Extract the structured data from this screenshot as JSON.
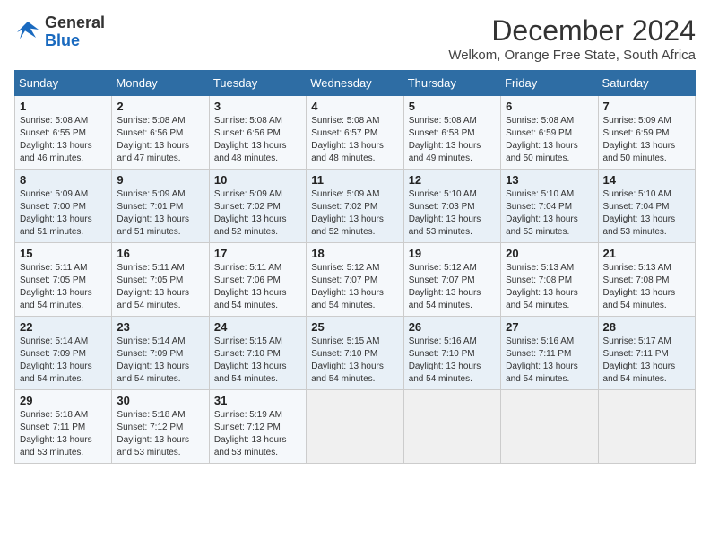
{
  "logo": {
    "line1": "General",
    "line2": "Blue"
  },
  "title": "December 2024",
  "subtitle": "Welkom, Orange Free State, South Africa",
  "weekdays": [
    "Sunday",
    "Monday",
    "Tuesday",
    "Wednesday",
    "Thursday",
    "Friday",
    "Saturday"
  ],
  "weeks": [
    [
      {
        "day": "1",
        "sunrise": "5:08 AM",
        "sunset": "6:55 PM",
        "daylight": "13 hours and 46 minutes."
      },
      {
        "day": "2",
        "sunrise": "5:08 AM",
        "sunset": "6:56 PM",
        "daylight": "13 hours and 47 minutes."
      },
      {
        "day": "3",
        "sunrise": "5:08 AM",
        "sunset": "6:56 PM",
        "daylight": "13 hours and 48 minutes."
      },
      {
        "day": "4",
        "sunrise": "5:08 AM",
        "sunset": "6:57 PM",
        "daylight": "13 hours and 48 minutes."
      },
      {
        "day": "5",
        "sunrise": "5:08 AM",
        "sunset": "6:58 PM",
        "daylight": "13 hours and 49 minutes."
      },
      {
        "day": "6",
        "sunrise": "5:08 AM",
        "sunset": "6:59 PM",
        "daylight": "13 hours and 50 minutes."
      },
      {
        "day": "7",
        "sunrise": "5:09 AM",
        "sunset": "6:59 PM",
        "daylight": "13 hours and 50 minutes."
      }
    ],
    [
      {
        "day": "8",
        "sunrise": "5:09 AM",
        "sunset": "7:00 PM",
        "daylight": "13 hours and 51 minutes."
      },
      {
        "day": "9",
        "sunrise": "5:09 AM",
        "sunset": "7:01 PM",
        "daylight": "13 hours and 51 minutes."
      },
      {
        "day": "10",
        "sunrise": "5:09 AM",
        "sunset": "7:02 PM",
        "daylight": "13 hours and 52 minutes."
      },
      {
        "day": "11",
        "sunrise": "5:09 AM",
        "sunset": "7:02 PM",
        "daylight": "13 hours and 52 minutes."
      },
      {
        "day": "12",
        "sunrise": "5:10 AM",
        "sunset": "7:03 PM",
        "daylight": "13 hours and 53 minutes."
      },
      {
        "day": "13",
        "sunrise": "5:10 AM",
        "sunset": "7:04 PM",
        "daylight": "13 hours and 53 minutes."
      },
      {
        "day": "14",
        "sunrise": "5:10 AM",
        "sunset": "7:04 PM",
        "daylight": "13 hours and 53 minutes."
      }
    ],
    [
      {
        "day": "15",
        "sunrise": "5:11 AM",
        "sunset": "7:05 PM",
        "daylight": "13 hours and 54 minutes."
      },
      {
        "day": "16",
        "sunrise": "5:11 AM",
        "sunset": "7:05 PM",
        "daylight": "13 hours and 54 minutes."
      },
      {
        "day": "17",
        "sunrise": "5:11 AM",
        "sunset": "7:06 PM",
        "daylight": "13 hours and 54 minutes."
      },
      {
        "day": "18",
        "sunrise": "5:12 AM",
        "sunset": "7:07 PM",
        "daylight": "13 hours and 54 minutes."
      },
      {
        "day": "19",
        "sunrise": "5:12 AM",
        "sunset": "7:07 PM",
        "daylight": "13 hours and 54 minutes."
      },
      {
        "day": "20",
        "sunrise": "5:13 AM",
        "sunset": "7:08 PM",
        "daylight": "13 hours and 54 minutes."
      },
      {
        "day": "21",
        "sunrise": "5:13 AM",
        "sunset": "7:08 PM",
        "daylight": "13 hours and 54 minutes."
      }
    ],
    [
      {
        "day": "22",
        "sunrise": "5:14 AM",
        "sunset": "7:09 PM",
        "daylight": "13 hours and 54 minutes."
      },
      {
        "day": "23",
        "sunrise": "5:14 AM",
        "sunset": "7:09 PM",
        "daylight": "13 hours and 54 minutes."
      },
      {
        "day": "24",
        "sunrise": "5:15 AM",
        "sunset": "7:10 PM",
        "daylight": "13 hours and 54 minutes."
      },
      {
        "day": "25",
        "sunrise": "5:15 AM",
        "sunset": "7:10 PM",
        "daylight": "13 hours and 54 minutes."
      },
      {
        "day": "26",
        "sunrise": "5:16 AM",
        "sunset": "7:10 PM",
        "daylight": "13 hours and 54 minutes."
      },
      {
        "day": "27",
        "sunrise": "5:16 AM",
        "sunset": "7:11 PM",
        "daylight": "13 hours and 54 minutes."
      },
      {
        "day": "28",
        "sunrise": "5:17 AM",
        "sunset": "7:11 PM",
        "daylight": "13 hours and 54 minutes."
      }
    ],
    [
      {
        "day": "29",
        "sunrise": "5:18 AM",
        "sunset": "7:11 PM",
        "daylight": "13 hours and 53 minutes."
      },
      {
        "day": "30",
        "sunrise": "5:18 AM",
        "sunset": "7:12 PM",
        "daylight": "13 hours and 53 minutes."
      },
      {
        "day": "31",
        "sunrise": "5:19 AM",
        "sunset": "7:12 PM",
        "daylight": "13 hours and 53 minutes."
      },
      null,
      null,
      null,
      null
    ]
  ],
  "labels": {
    "sunrise": "Sunrise:",
    "sunset": "Sunset:",
    "daylight": "Daylight:"
  }
}
